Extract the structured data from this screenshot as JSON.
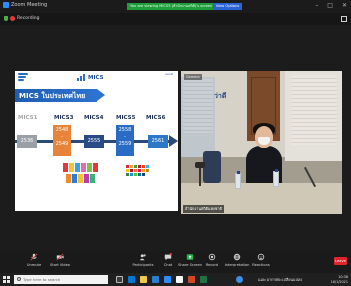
{
  "window": {
    "app_title": "Zoom Meeting",
    "banner_text": "You are viewing MICS5 (สำนักงานสถิติ)'s screen",
    "banner_button": "View Options",
    "controls": [
      "–",
      "□",
      "✕"
    ]
  },
  "recording": {
    "label": "Recording"
  },
  "slide": {
    "brand": "MICS",
    "title": "MICS ในประเทศไทย",
    "right_logo_text": "unicef",
    "milestones": [
      {
        "name": "MICS1",
        "years": [
          "2536"
        ]
      },
      {
        "name": "MICS3",
        "years": [
          "2548",
          "-",
          "2549"
        ]
      },
      {
        "name": "MICS4",
        "years": [
          "2555"
        ]
      },
      {
        "name": "MICS5",
        "years": [
          "2558",
          "-",
          "2559"
        ]
      },
      {
        "name": "MICS6",
        "years": [
          "2561"
        ]
      }
    ]
  },
  "video": {
    "sign_text": "ว่าดี",
    "self_tag": "Gamora",
    "participant_label": "สำนักงานสถิติแห่งชาติ"
  },
  "toolbar": {
    "items": [
      {
        "label": "Unmute",
        "icon": "microphone-icon"
      },
      {
        "label": "Start Video",
        "icon": "video-camera-icon"
      },
      {
        "label": "Participants",
        "icon": "participants-icon"
      },
      {
        "label": "Chat",
        "icon": "chat-icon"
      },
      {
        "label": "Share Screen",
        "icon": "share-screen-icon"
      },
      {
        "label": "Record",
        "icon": "record-icon"
      },
      {
        "label": "Interpretation",
        "icon": "globe-icon"
      },
      {
        "label": "Reactions",
        "icon": "reactions-icon"
      }
    ],
    "leave_label": "Leave"
  },
  "taskbar": {
    "search_placeholder": "Type here to search",
    "tray_text": "แมพ อากาศจะเปลี่ยนแปลง",
    "time": "10:36",
    "date": "16/1/2021"
  },
  "colors": {
    "accent": "#2d8cff",
    "banner": "#1f9d3a",
    "leave": "#e0242b",
    "slide_band": "#1f5db3"
  }
}
